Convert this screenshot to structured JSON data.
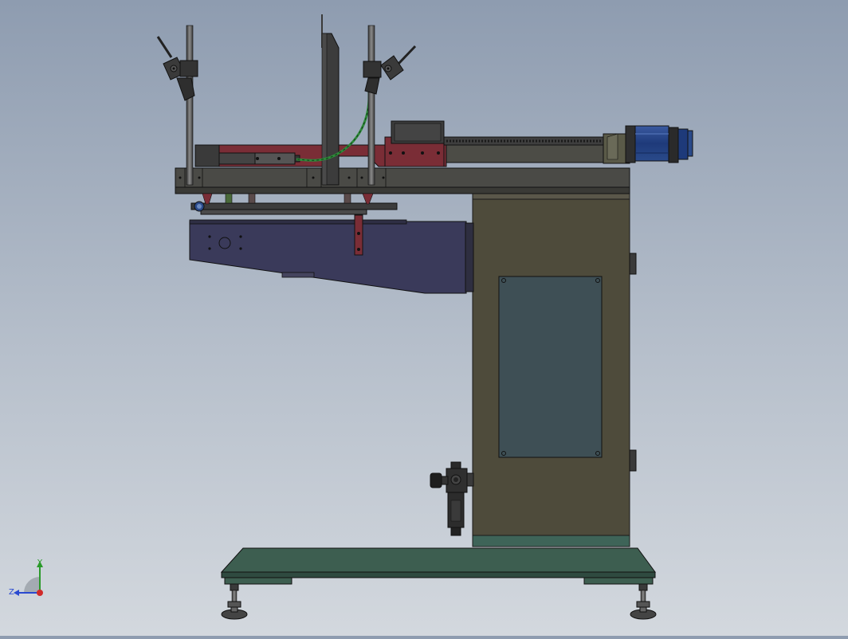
{
  "viewport": {
    "model": "welding-machine-side-view",
    "colors": {
      "background_top": "#8e9cb0",
      "background_bottom": "#d3d8de",
      "frame_olive": "#4e4b3b",
      "arm_navy": "#3a3a5a",
      "base_green": "#3d5e50",
      "carriage_maroon": "#7a2d36",
      "motor_blue": "#2a4a8a",
      "cable_green": "#2f8a3a",
      "door_panel": "#3e4f55"
    }
  },
  "triad": {
    "y_label": "Y",
    "z_label": "Z",
    "colors": {
      "y": "#2a9a2a",
      "z": "#2a4ad0",
      "x": "#d02a2a"
    }
  }
}
